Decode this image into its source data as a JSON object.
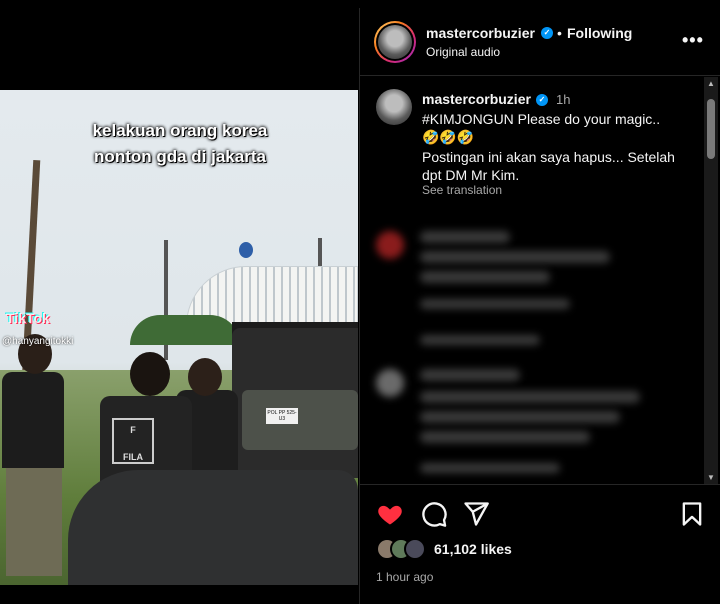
{
  "video": {
    "caption_overlay_line1": "kelakuan orang korea",
    "caption_overlay_line2": "nonton gda di jakarta",
    "watermark_brand": "TikTok",
    "watermark_user": "@hanyangitokki",
    "plate_text": "POL PP 525-U3",
    "shirt_text": "FILA"
  },
  "header": {
    "username": "mastercorbuzier",
    "separator": "•",
    "follow_status": "Following",
    "audio": "Original audio",
    "more_icon": "more-horizontal-icon"
  },
  "caption": {
    "username": "mastercorbuzier",
    "time": "1h",
    "line1": "#KIMJONGUN Please do your magic..",
    "emojis": "🤣🤣🤣",
    "line2": "Postingan ini akan saya hapus... Setelah",
    "line3": "dpt DM Mr Kim.",
    "see_translation": "See translation"
  },
  "actions": {
    "like_icon": "heart-filled-icon",
    "comment_icon": "comment-icon",
    "share_icon": "send-icon",
    "save_icon": "bookmark-icon",
    "likes": "61,102 likes",
    "posted": "1 hour ago",
    "like_color": "#ff3040"
  },
  "colors": {
    "verified": "#0095f6",
    "muted_text": "#a8a8a8"
  }
}
